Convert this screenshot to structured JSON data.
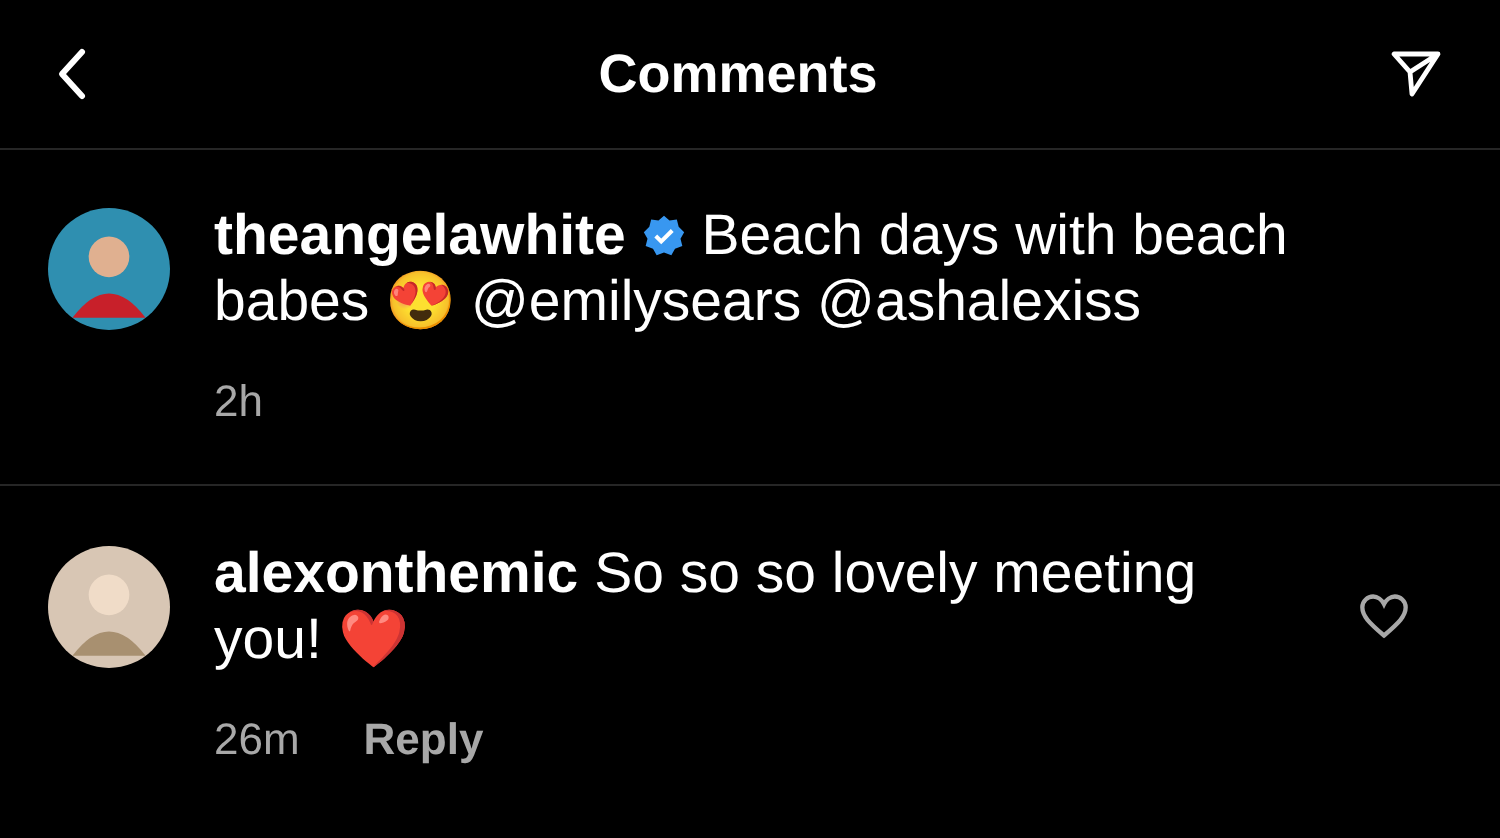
{
  "header": {
    "title": "Comments"
  },
  "comments": [
    {
      "kind": "caption",
      "username": "theangelawhite",
      "verified": true,
      "text": "Beach days with beach babes 😍 @emilysears @ashalexiss",
      "time": "2h"
    },
    {
      "kind": "comment",
      "username": "alexonthemic",
      "verified": false,
      "text": "So so so lovely meeting you! ❤️",
      "time": "26m",
      "reply": "Reply",
      "liked": false
    }
  ]
}
